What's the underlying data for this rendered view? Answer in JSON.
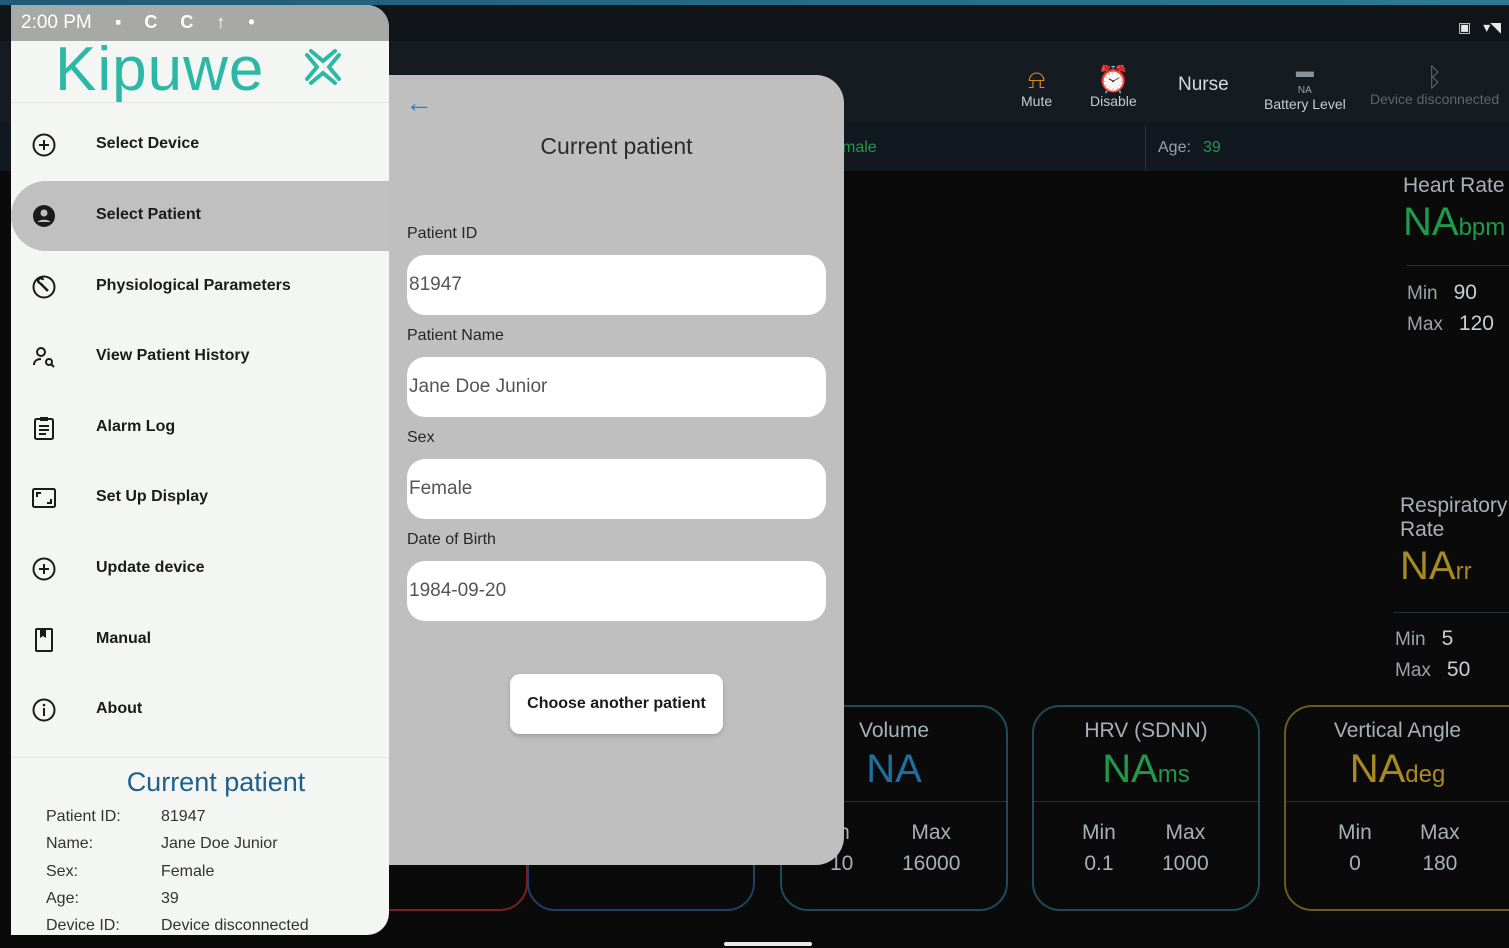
{
  "status_bar": {
    "time": "2:00 PM",
    "left_icons": "▪ C C ↑ •"
  },
  "app_bar": {
    "mute_label": "Mute",
    "disable_label": "Disable",
    "role": "Nurse",
    "battery_value": "NA",
    "battery_label": "Battery Level",
    "device_status": "Device disconnected"
  },
  "info_bar": {
    "sex_partial": "male",
    "age_label": "Age:",
    "age_value": "39"
  },
  "vitals": {
    "heart_rate": {
      "label": "Heart Rate",
      "value": "NA",
      "unit": "bpm",
      "min_label": "Min",
      "min": "90",
      "max_label": "Max",
      "max": "120"
    },
    "respiratory_rate": {
      "label": "Respiratory Rate",
      "value": "NA",
      "unit": "rr",
      "min_label": "Min",
      "min": "5",
      "max_label": "Max",
      "max": "50"
    }
  },
  "cards": [
    {
      "title": "Volume",
      "value": "NA",
      "unit": "",
      "min_label": "in",
      "min": "10",
      "max_label": "Max",
      "max": "16000"
    },
    {
      "title": "HRV (SDNN)",
      "value": "NA",
      "unit": "ms",
      "min_label": "Min",
      "min": "0.1",
      "max_label": "Max",
      "max": "1000"
    },
    {
      "title": "Vertical Angle",
      "value": "NA",
      "unit": "deg",
      "min_label": "Min",
      "min": "0",
      "max_label": "Max",
      "max": "180"
    }
  ],
  "modal": {
    "title": "Current patient",
    "patient_id_label": "Patient ID",
    "patient_id": "81947",
    "patient_name_label": "Patient Name",
    "patient_name": "Jane Doe Junior",
    "sex_label": "Sex",
    "sex": "Female",
    "dob_label": "Date of Birth",
    "dob": "1984-09-20",
    "choose_button": "Choose another patient"
  },
  "drawer": {
    "logo_text": "Kipuwe",
    "items": [
      {
        "label": "Select Device",
        "icon": "add-circle-icon"
      },
      {
        "label": "Select Patient",
        "icon": "account-circle-icon"
      },
      {
        "label": "Physiological Parameters",
        "icon": "wrench-circle-icon"
      },
      {
        "label": "View Patient History",
        "icon": "person-search-icon"
      },
      {
        "label": "Alarm Log",
        "icon": "clipboard-icon"
      },
      {
        "label": "Set Up Display",
        "icon": "display-frame-icon"
      },
      {
        "label": "Update device",
        "icon": "add-circle-icon"
      },
      {
        "label": "Manual",
        "icon": "book-icon"
      },
      {
        "label": "About",
        "icon": "info-icon"
      }
    ],
    "current_patient": {
      "title": "Current patient",
      "rows": [
        {
          "label": "Patient ID:",
          "value": "81947"
        },
        {
          "label": "Name:",
          "value": "Jane Doe Junior"
        },
        {
          "label": "Sex:",
          "value": "Female"
        },
        {
          "label": "Age:",
          "value": "39"
        },
        {
          "label": "Device ID:",
          "value": "Device disconnected"
        }
      ]
    }
  },
  "colors": {
    "green": "#1f9a4a",
    "yellow": "#a88a22",
    "teal": "#2db8a6",
    "blue_title": "#1f5f8b"
  }
}
